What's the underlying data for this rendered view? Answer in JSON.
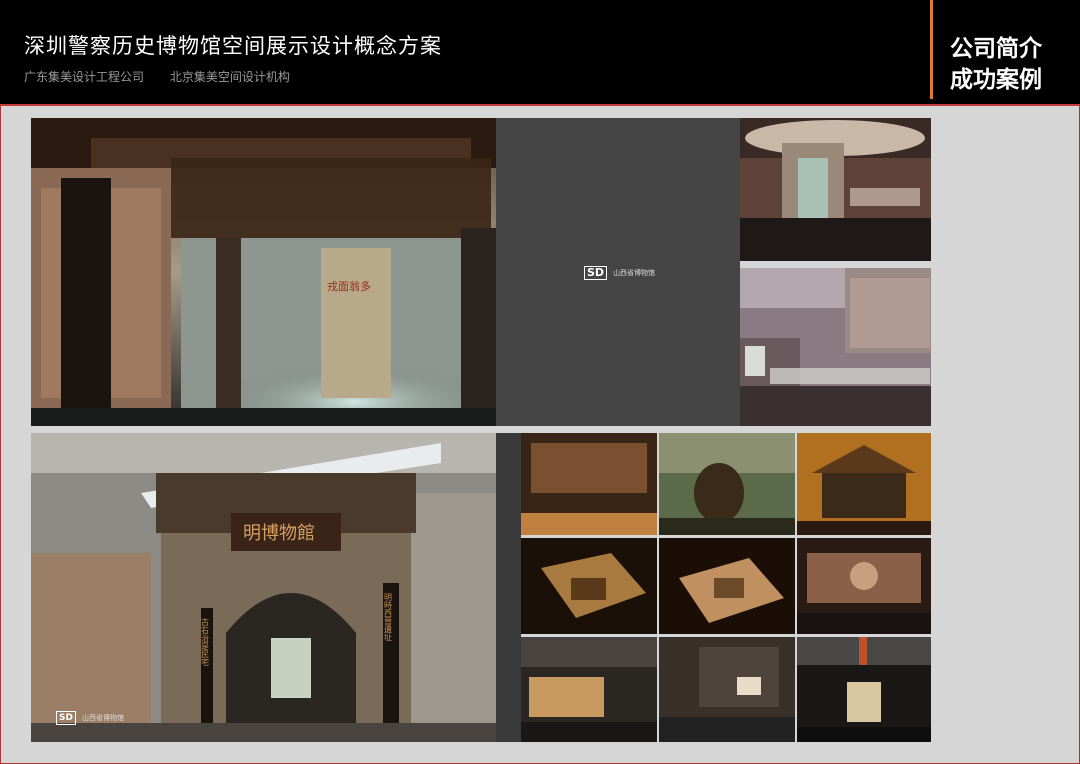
{
  "header": {
    "title": "深圳警察历史博物馆空间展示设计概念方案",
    "company_1": "广东集美设计工程公司",
    "company_2": "北京集美空间设计机构",
    "side_line_1": "公司简介",
    "side_line_2": "成功案例"
  },
  "gallery": {
    "logo_mark": "SD",
    "logo_text": "山西省博物馆",
    "photo_wall_text": "戎面翁多",
    "gate_plaque": "明博物館",
    "gate_couplet_left": "古右治是民宅",
    "gate_couplet_right": "明時西晉遺址",
    "photo2_logo_text": "山西省博物馆",
    "colors": {
      "accent": "#e07a2e",
      "rule": "#c43a3a",
      "background": "#d6d6d6",
      "header": "#000000"
    }
  }
}
